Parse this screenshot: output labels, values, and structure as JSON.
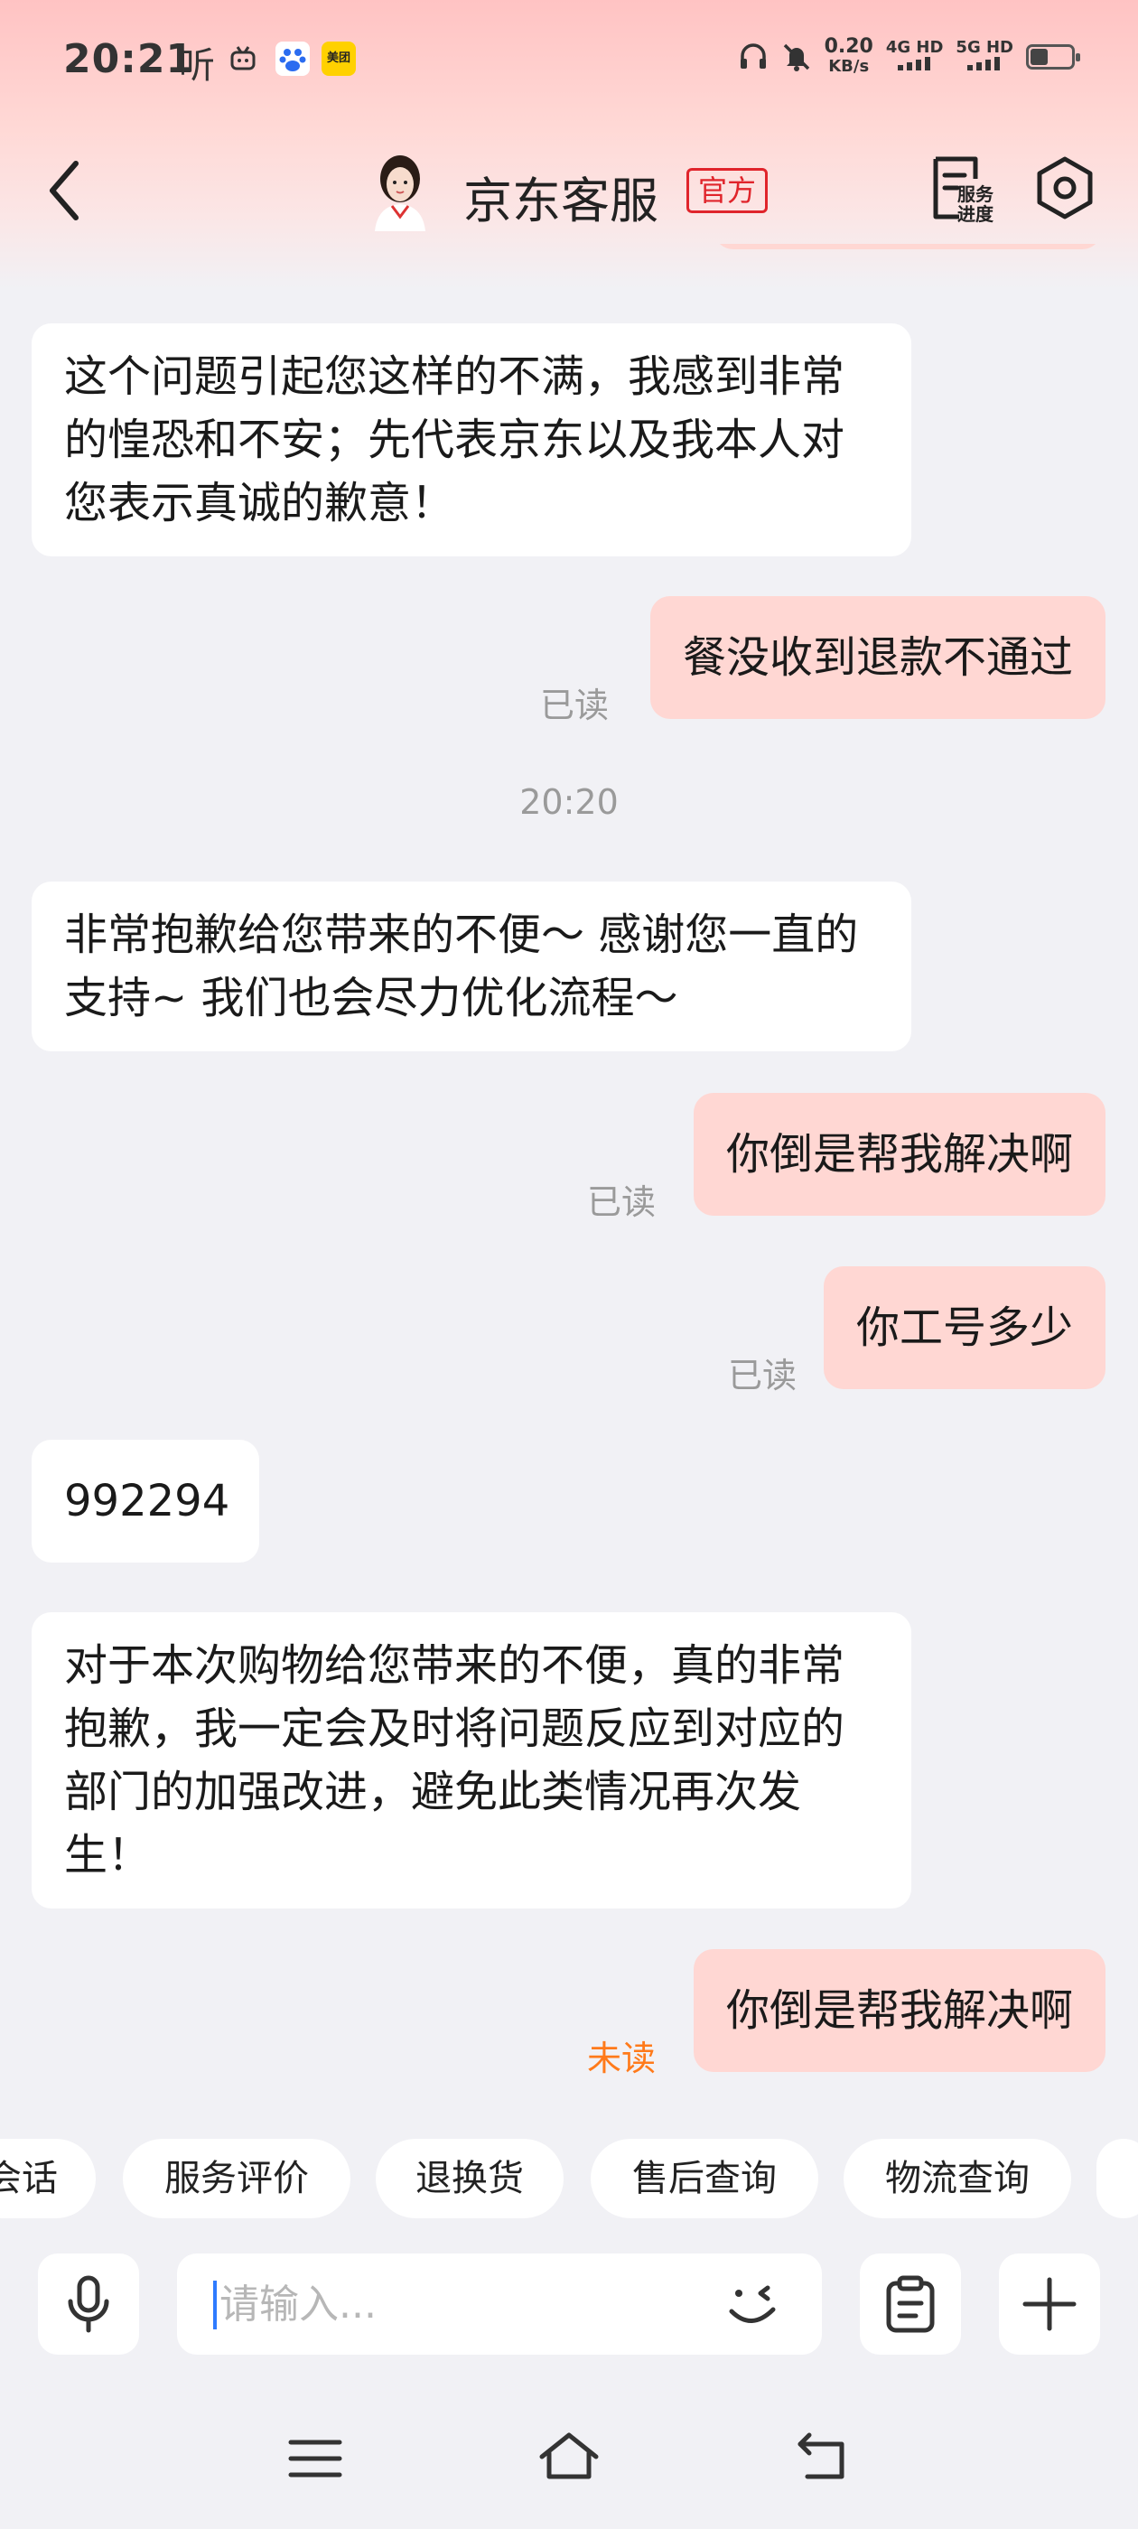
{
  "status_bar": {
    "time": "20:21",
    "listen_label": "听",
    "net_speed_value": "0.20",
    "net_speed_unit": "KB/s",
    "sim1": "4G HD",
    "sim2": "5G HD",
    "meituan_label": "美团"
  },
  "header": {
    "title": "京东客服",
    "badge": "官方",
    "service_progress_label": "服务进度"
  },
  "messages": {
    "m1": "这个问题引起您这样的不满，我感到非常的惶恐和不安；先代表京东以及我本人对您表示真诚的歉意！",
    "m2": "餐没收到退款不通过",
    "m2_status": "已读",
    "timestamp": "20:20",
    "m3": "非常抱歉给您带来的不便～  感谢您一直的支持~  我们也会尽力优化流程～",
    "m4": "你倒是帮我解决啊",
    "m4_status": "已读",
    "m5": "你工号多少",
    "m5_status": "已读",
    "m6": "992294",
    "m7": "对于本次购物给您带来的不便，真的非常抱歉，我一定会及时将问题反应到对应的部门的加强改进，避免此类情况再次发生！",
    "m8": "你倒是帮我解决啊",
    "m8_status": "未读"
  },
  "quick_replies": [
    "会话",
    "服务评价",
    "退换货",
    "售后查询",
    "物流查询"
  ],
  "input": {
    "placeholder": "请输入..."
  },
  "colors": {
    "accent_red": "#e0242b",
    "bubble_user": "#ffd7d3",
    "unread_orange": "#ff7a1a",
    "background": "#f1f1f5"
  }
}
